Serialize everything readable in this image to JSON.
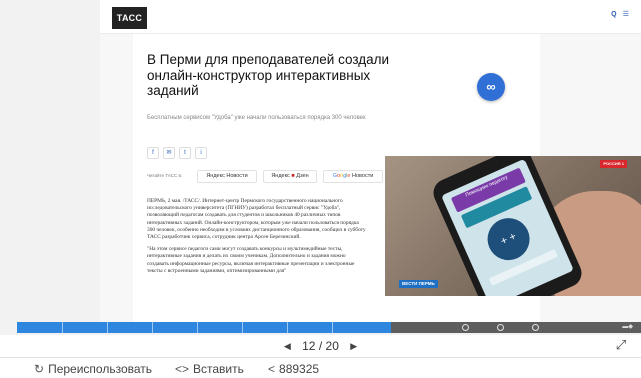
{
  "site": {
    "logo_text": "ТАСС",
    "header_links": [
      "Q",
      "☰"
    ],
    "header_search_label": "",
    "header_menu_label": ""
  },
  "article": {
    "date": "",
    "title": "В Перми для преподавателей создали онлайн-конструктор интерактивных заданий",
    "lead": "Бесплатным сервисом \"Удоба\" уже начали пользоваться порядка 300 человек",
    "share_buttons": [
      "f",
      "✉",
      "t",
      "i"
    ],
    "source_label": "Читайте ТАСС в:",
    "sources": {
      "yandex_news": "Яндекс Новости",
      "yandex_zen_prefix": "Яндекс",
      "yandex_zen_suffix": "Дзен",
      "google_news_word": "Новости"
    },
    "body_paragraphs": [
      "ПЕРМЬ, 2 мая. /ТАСС/. Интернет-центр Пермского государственного национального исследовательского университета (ПГНИУ) разработал бесплатный сервис \"Удоба\", позволяющий педагогам создавать для студентов и школьников 40 различных типов интерактивных заданий. Онлайн-конструктором, которым уже начали пользоваться порядка 300 человек, особенно необходим в условиях дистанционного образования, сообщил в субботу ТАСС разработчик сервиса, сотрудник центра Арсен Березинский.",
      "\"На этом сервисе педагоги сами могут создавать конкурсы и мультимедийные тесты, интерактивные задания и делать их своим ученикам. Дополнительно и задания можно создавать информационные ресурсы, включая интерактивные презентации и электронные тексты с встроенными заданиями, оптимизированными для\""
    ]
  },
  "video": {
    "channel_badge": "РОССИЯ 1",
    "caption": "ВЕСТИ ПЕРМЬ",
    "phone_title": "Помощник педагогу",
    "phone_circle_symbols": "+ +"
  },
  "viewer": {
    "progress_fraction": 0.6,
    "current_slide": "12",
    "total_slides": "20",
    "separator": "/",
    "prev_symbol": "◀",
    "next_symbol": "▶",
    "strip_end_glyph": "▬◆"
  },
  "actions": {
    "reuse_label": "Переиспользовать",
    "embed_label": "Вставить",
    "share_count": "889325"
  },
  "colors": {
    "accent_blue": "#2e86de",
    "fab_blue": "#2f6fd6",
    "logo_bg": "#222222"
  }
}
